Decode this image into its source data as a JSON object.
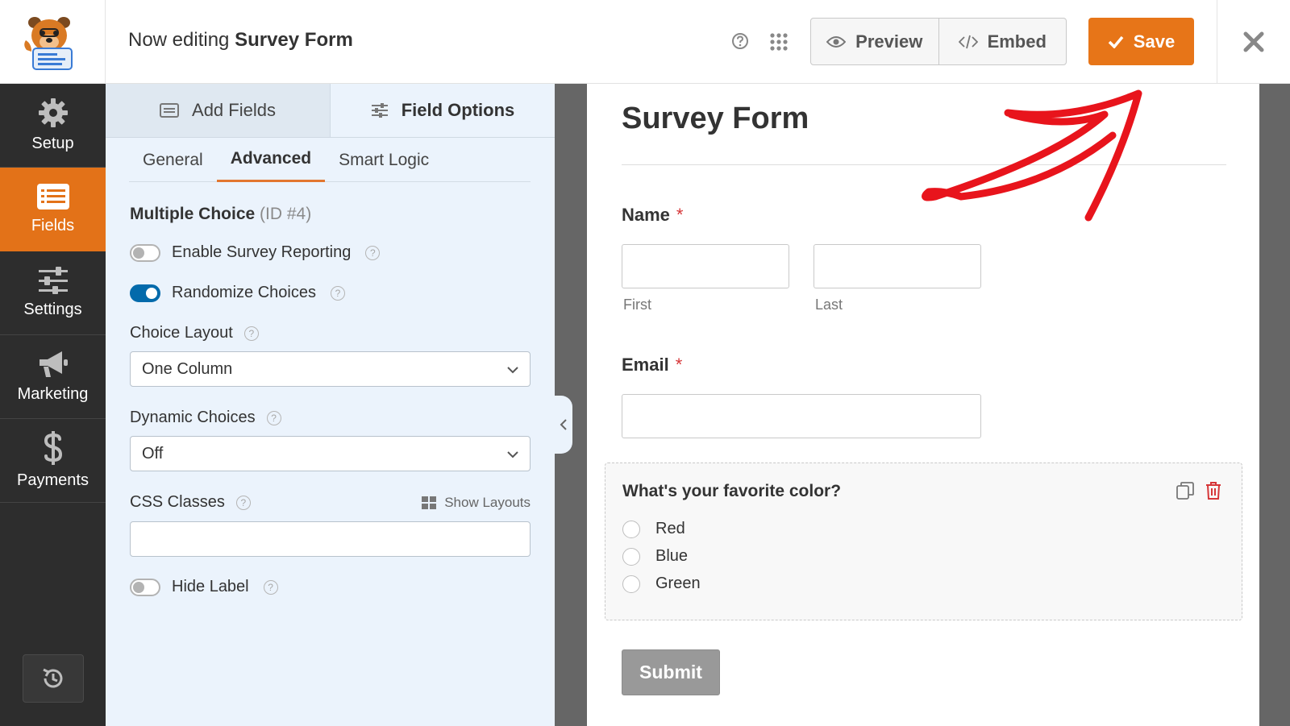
{
  "header": {
    "title_prefix": "Now editing",
    "title_form": "Survey Form",
    "preview_label": "Preview",
    "embed_label": "Embed",
    "save_label": "Save",
    "icons": [
      "logo-icon",
      "help-icon",
      "apps-grid-icon",
      "eye-icon",
      "code-icon",
      "check-icon",
      "close-icon"
    ]
  },
  "sidebar": {
    "items": [
      {
        "label": "Setup",
        "icon": "gear-icon"
      },
      {
        "label": "Fields",
        "icon": "fields-icon",
        "active": true
      },
      {
        "label": "Settings",
        "icon": "sliders-icon"
      },
      {
        "label": "Marketing",
        "icon": "megaphone-icon"
      },
      {
        "label": "Payments",
        "icon": "dollar-icon"
      }
    ],
    "history_icon": "history-icon"
  },
  "panel": {
    "tabs": {
      "add_fields": "Add Fields",
      "field_options": "Field Options"
    },
    "subtabs": {
      "general": "General",
      "advanced": "Advanced",
      "smart_logic": "Smart Logic"
    },
    "field_title": "Multiple Choice",
    "field_id": "(ID #4)",
    "enable_survey_reporting": "Enable Survey Reporting",
    "randomize_choices": "Randomize Choices",
    "choice_layout_label": "Choice Layout",
    "choice_layout_value": "One Column",
    "dynamic_choices_label": "Dynamic Choices",
    "dynamic_choices_value": "Off",
    "css_classes_label": "CSS Classes",
    "show_layouts": "Show Layouts",
    "hide_label": "Hide Label",
    "toggles": {
      "enable_survey_reporting": false,
      "randomize_choices": true,
      "hide_label": false
    }
  },
  "form": {
    "title": "Survey Form",
    "name_label": "Name",
    "first_label": "First",
    "last_label": "Last",
    "email_label": "Email",
    "required_mark": "*",
    "question": "What's your favorite color?",
    "options": [
      "Red",
      "Blue",
      "Green"
    ],
    "submit_label": "Submit"
  },
  "colors": {
    "accent": "#e77518",
    "sidebar": "#2d2d2d",
    "toggle_on": "#036aab",
    "annotation": "#e8141c"
  }
}
